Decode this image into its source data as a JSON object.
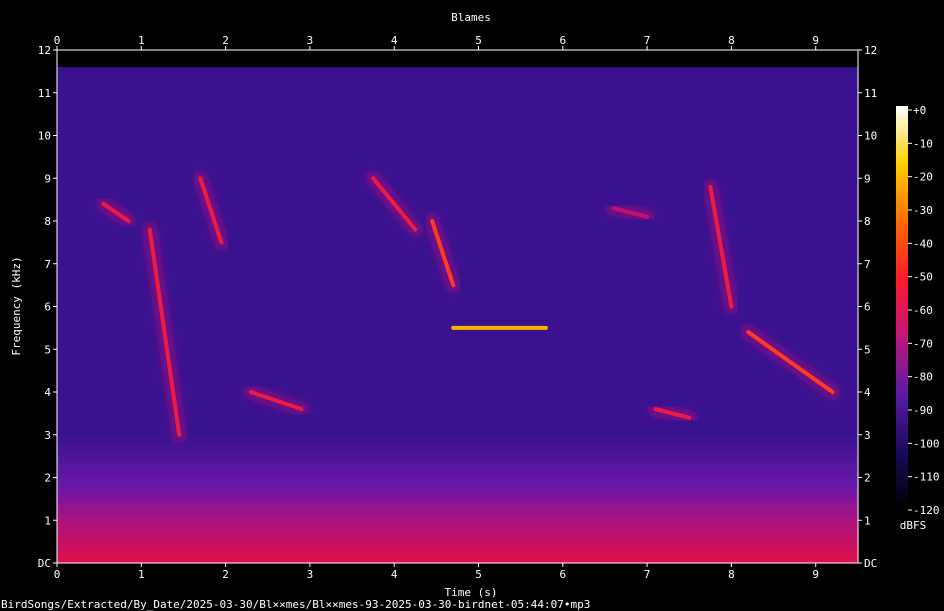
{
  "chart_data": {
    "type": "heatmap",
    "title": "Blames",
    "xlabel": "Time (s)",
    "ylabel": "Frequency (kHz)",
    "x_ticks": [
      "0",
      "1",
      "2",
      "3",
      "4",
      "5",
      "6",
      "7",
      "8",
      "9"
    ],
    "y_ticks": [
      "DC",
      "1",
      "2",
      "3",
      "4",
      "5",
      "6",
      "7",
      "8",
      "9",
      "10",
      "11",
      "12"
    ],
    "xlim": [
      0,
      9.5
    ],
    "ylim": [
      0,
      12
    ],
    "colorbar": {
      "label": "dBFS",
      "ticks": [
        "+0",
        "-10",
        "-20",
        "-30",
        "-40",
        "-50",
        "-60",
        "-70",
        "-80",
        "-90",
        "-100",
        "-110",
        "-120"
      ],
      "range": [
        -120,
        0
      ],
      "stops": [
        "#000000",
        "#1a0a5c",
        "#5a1aa8",
        "#c0157a",
        "#ff1a2a",
        "#ff6a00",
        "#ffd000",
        "#ffffff"
      ]
    },
    "calls": [
      {
        "t0": 0.55,
        "t1": 0.85,
        "f0": 8.4,
        "f1": 8.0,
        "level": -45
      },
      {
        "t0": 1.1,
        "t1": 1.45,
        "f0": 7.8,
        "f1": 3.0,
        "level": -40
      },
      {
        "t0": 1.7,
        "t1": 1.95,
        "f0": 9.0,
        "f1": 7.5,
        "level": -45
      },
      {
        "t0": 2.3,
        "t1": 2.9,
        "f0": 4.0,
        "f1": 3.6,
        "level": -40
      },
      {
        "t0": 3.75,
        "t1": 4.25,
        "f0": 9.0,
        "f1": 7.8,
        "level": -40
      },
      {
        "t0": 4.45,
        "t1": 4.7,
        "f0": 8.0,
        "f1": 6.5,
        "level": -35
      },
      {
        "t0": 4.7,
        "t1": 5.8,
        "f0": 5.5,
        "f1": 5.5,
        "level": -20
      },
      {
        "t0": 6.6,
        "t1": 7.0,
        "f0": 8.3,
        "f1": 8.1,
        "level": -50
      },
      {
        "t0": 7.1,
        "t1": 7.5,
        "f0": 3.6,
        "f1": 3.4,
        "level": -40
      },
      {
        "t0": 7.75,
        "t1": 8.0,
        "f0": 8.8,
        "f1": 6.0,
        "level": -40
      },
      {
        "t0": 8.2,
        "t1": 9.2,
        "f0": 5.4,
        "f1": 4.0,
        "level": -35
      }
    ]
  },
  "footer": {
    "filename": "BirdSongs/Extracted/By_Date/2025-03-30/Bl××mes/Bl××mes-93-2025-03-30-birdnet-05:44:07•mp3"
  }
}
